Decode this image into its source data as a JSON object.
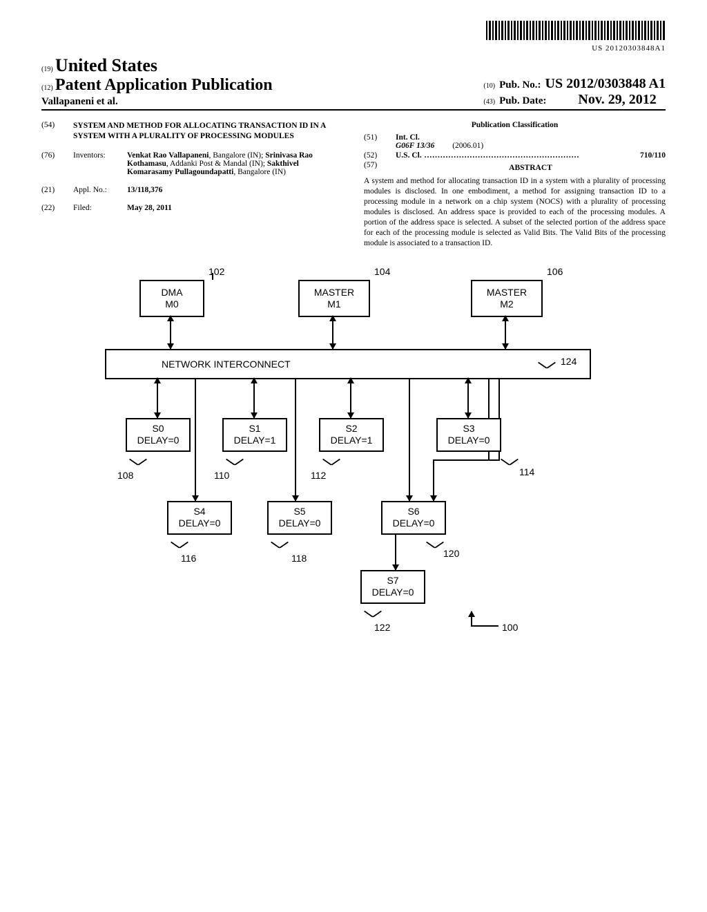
{
  "barcode_number": "US 20120303848A1",
  "header": {
    "code19": "(19)",
    "country": "United States",
    "code12": "(12)",
    "pub_type": "Patent Application Publication",
    "authors_line": "Vallapaneni et al.",
    "code10": "(10)",
    "pub_no_label": "Pub. No.:",
    "pub_no": "US 2012/0303848 A1",
    "code43": "(43)",
    "pub_date_label": "Pub. Date:",
    "pub_date": "Nov. 29, 2012"
  },
  "left": {
    "code54": "(54)",
    "title": "SYSTEM AND METHOD FOR ALLOCATING TRANSACTION ID IN A SYSTEM WITH A PLURALITY OF PROCESSING MODULES",
    "code76": "(76)",
    "inventors_label": "Inventors:",
    "inventors": "Venkat Rao Vallapaneni, Bangalore (IN); Srinivasa Rao Kothamasu, Addanki Post & Mandal (IN); Sakthivel Komarasamy Pullagoundapatti, Bangalore (IN)",
    "code21": "(21)",
    "applno_label": "Appl. No.:",
    "applno": "13/118,376",
    "code22": "(22)",
    "filed_label": "Filed:",
    "filed": "May 28, 2011"
  },
  "right": {
    "classif_head": "Publication Classification",
    "code51": "(51)",
    "intcl_label": "Int. Cl.",
    "intcl_code": "G06F 13/36",
    "intcl_ver": "(2006.01)",
    "code52": "(52)",
    "uscl_label": "U.S. Cl.",
    "uscl_val": "710/110",
    "code57": "(57)",
    "abstract_head": "ABSTRACT",
    "abstract": "A system and method for allocating transaction ID in a system with a plurality of processing modules is disclosed. In one embodiment, a method for assigning transaction ID to a processing module in a network on a chip system (NOCS) with a plurality of processing modules is disclosed. An address space is provided to each of the processing modules. A portion of the address space is selected. A subset of the selected portion of the address space for each of the processing module is selected as Valid Bits. The Valid Bits of the processing module is associated to a transaction ID."
  },
  "figure": {
    "masters": [
      {
        "label": "DMA\nM0",
        "ref": "102"
      },
      {
        "label": "MASTER\nM1",
        "ref": "104"
      },
      {
        "label": "MASTER\nM2",
        "ref": "106"
      }
    ],
    "interconnect": {
      "label": "NETWORK INTERCONNECT",
      "ref": "124"
    },
    "slaves_row1": [
      {
        "name": "S0",
        "delay": "DELAY=0",
        "ref": "108"
      },
      {
        "name": "S1",
        "delay": "DELAY=1",
        "ref": "110"
      },
      {
        "name": "S2",
        "delay": "DELAY=1",
        "ref": "112"
      },
      {
        "name": "S3",
        "delay": "DELAY=0",
        "ref": "114"
      }
    ],
    "slaves_row2": [
      {
        "name": "S4",
        "delay": "DELAY=0",
        "ref": "116"
      },
      {
        "name": "S5",
        "delay": "DELAY=0",
        "ref": "118"
      },
      {
        "name": "S6",
        "delay": "DELAY=0",
        "ref": "120"
      }
    ],
    "slaves_row3": [
      {
        "name": "S7",
        "delay": "DELAY=0",
        "ref": "122"
      }
    ],
    "fig_ref": "100"
  }
}
